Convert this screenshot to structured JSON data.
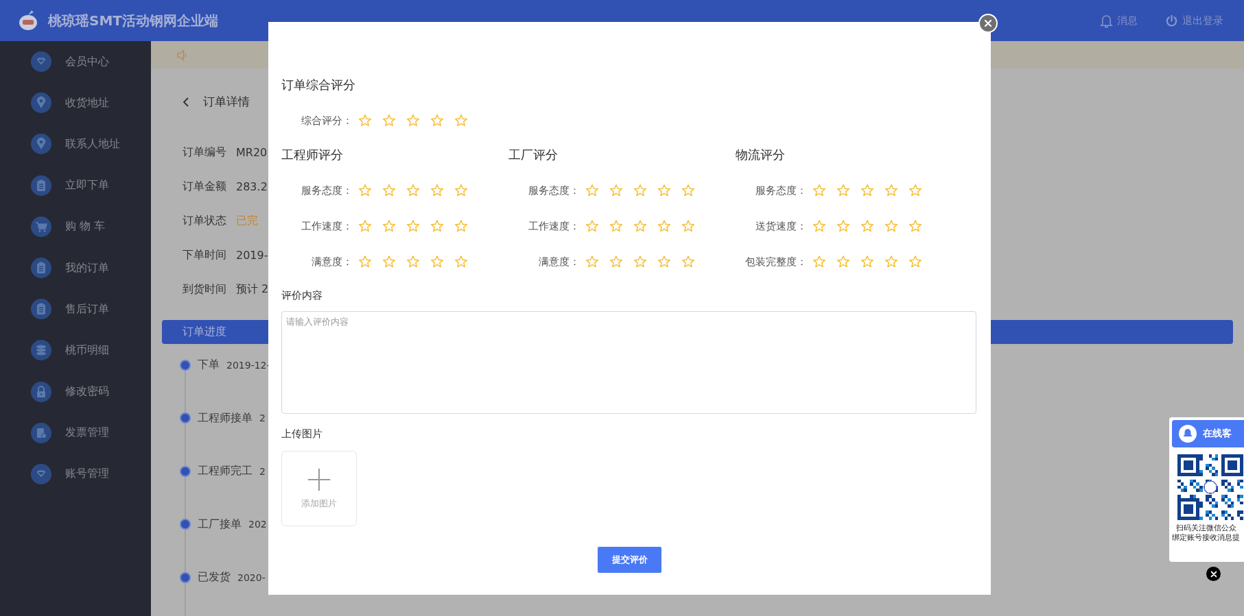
{
  "header": {
    "title": "桃琼瑶SMT活动钢网企业端",
    "actions": [
      {
        "kind": "bell",
        "label": "消息"
      },
      {
        "kind": "power",
        "label": "退出登录"
      }
    ]
  },
  "sidebar": {
    "items": [
      {
        "label": "会员中心"
      },
      {
        "label": "收货地址"
      },
      {
        "label": "联系人地址"
      },
      {
        "label": "立即下单"
      },
      {
        "label": "购 物 车"
      },
      {
        "label": "我的订单"
      },
      {
        "label": "售后订单"
      },
      {
        "label": "桃币明细"
      },
      {
        "label": "修改密码"
      },
      {
        "label": "发票管理"
      },
      {
        "label": "账号管理"
      }
    ]
  },
  "order": {
    "title": "订单详情",
    "fields": [
      {
        "label": "订单编号",
        "value": "MR20",
        "kind": "plain"
      },
      {
        "label": "订单金额",
        "value": "283.2",
        "kind": "plain"
      },
      {
        "label": "订单状态",
        "value": "已完",
        "kind": "status"
      },
      {
        "label": "下单时间",
        "value": "2019-",
        "kind": "plain"
      },
      {
        "label": "到货时间",
        "value": "预计 2",
        "kind": "plain"
      }
    ]
  },
  "progress": {
    "title": "订单进度",
    "steps": [
      {
        "label": "下单",
        "time": "2019-12-"
      },
      {
        "label": "工程师接单",
        "time": "2"
      },
      {
        "label": "工程师完工",
        "time": "2"
      },
      {
        "label": "工厂接单",
        "time": "202"
      },
      {
        "label": "已发货",
        "time": "2020-"
      }
    ]
  },
  "dialog": {
    "overall": {
      "title": "订单综合评分",
      "rows": [
        {
          "label": "综合评分：",
          "stars": 0
        }
      ]
    },
    "groups": [
      {
        "title": "工程师评分",
        "rows": [
          {
            "label": "服务态度：",
            "stars": 0
          },
          {
            "label": "工作速度：",
            "stars": 0
          },
          {
            "label": "满意度：",
            "stars": 0
          }
        ]
      },
      {
        "title": "工厂评分",
        "rows": [
          {
            "label": "服务态度：",
            "stars": 0
          },
          {
            "label": "工作速度：",
            "stars": 0
          },
          {
            "label": "满意度：",
            "stars": 0
          }
        ]
      },
      {
        "title": "物流评分",
        "rows": [
          {
            "label": "服务态度：",
            "stars": 0
          },
          {
            "label": "送货速度：",
            "stars": 0
          },
          {
            "label": "包装完整度：",
            "stars": 0
          }
        ]
      }
    ],
    "comment": {
      "label": "评价内容",
      "placeholder": "请输入评价内容"
    },
    "upload": {
      "label": "上传图片",
      "button": "添加图片"
    },
    "submit": "提交评价"
  },
  "service_widget": {
    "title": "在线客",
    "caption": [
      "扫码关注微信公众",
      "绑定账号接收消息提"
    ]
  }
}
